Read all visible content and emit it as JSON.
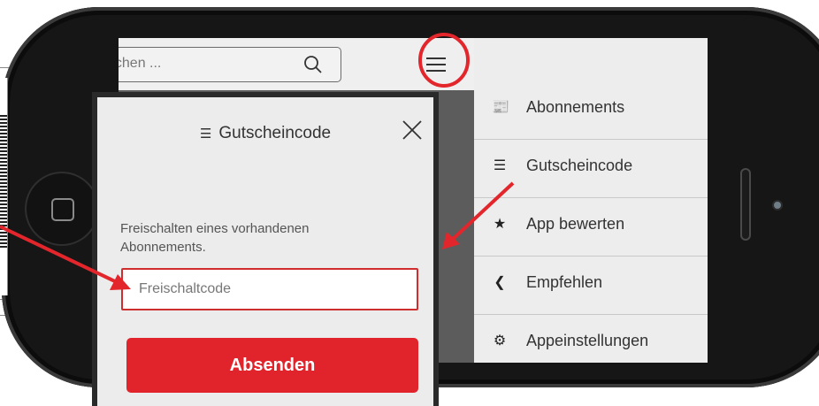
{
  "search": {
    "placeholder": "uchen ..."
  },
  "menu": {
    "items": [
      {
        "label": "Abonnements",
        "icon": "subscriptions-icon"
      },
      {
        "label": "Gutscheincode",
        "icon": "voucher-icon"
      },
      {
        "label": "App bewerten",
        "icon": "star-icon"
      },
      {
        "label": "Empfehlen",
        "icon": "share-icon"
      },
      {
        "label": "Appeinstellungen",
        "icon": "settings-icon"
      }
    ]
  },
  "dialog": {
    "title": "Gutscheincode",
    "description": "Freischalten eines vorhandenen Abonnements.",
    "input_placeholder": "Freischaltcode",
    "submit_label": "Absenden"
  },
  "colors": {
    "accent": "#e1242b",
    "annotation": "#e3262c",
    "menu_bg": "#ededed",
    "overlay": "#5c5c5c",
    "phone": "#161616"
  }
}
